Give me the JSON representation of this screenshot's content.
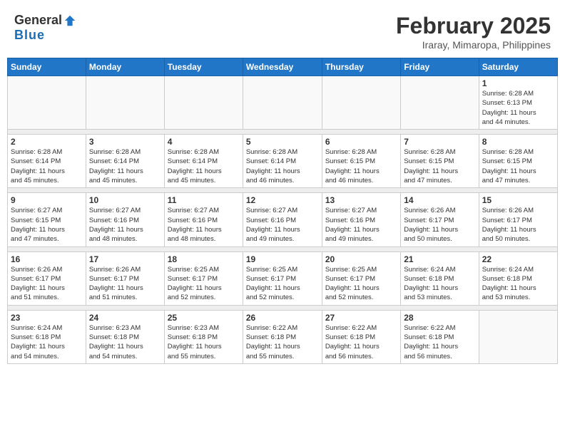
{
  "logo": {
    "general": "General",
    "blue": "Blue"
  },
  "header": {
    "month": "February 2025",
    "location": "Iraray, Mimaropa, Philippines"
  },
  "weekdays": [
    "Sunday",
    "Monday",
    "Tuesday",
    "Wednesday",
    "Thursday",
    "Friday",
    "Saturday"
  ],
  "weeks": [
    [
      {
        "day": "",
        "info": ""
      },
      {
        "day": "",
        "info": ""
      },
      {
        "day": "",
        "info": ""
      },
      {
        "day": "",
        "info": ""
      },
      {
        "day": "",
        "info": ""
      },
      {
        "day": "",
        "info": ""
      },
      {
        "day": "1",
        "info": "Sunrise: 6:28 AM\nSunset: 6:13 PM\nDaylight: 11 hours\nand 44 minutes."
      }
    ],
    [
      {
        "day": "2",
        "info": "Sunrise: 6:28 AM\nSunset: 6:14 PM\nDaylight: 11 hours\nand 45 minutes."
      },
      {
        "day": "3",
        "info": "Sunrise: 6:28 AM\nSunset: 6:14 PM\nDaylight: 11 hours\nand 45 minutes."
      },
      {
        "day": "4",
        "info": "Sunrise: 6:28 AM\nSunset: 6:14 PM\nDaylight: 11 hours\nand 45 minutes."
      },
      {
        "day": "5",
        "info": "Sunrise: 6:28 AM\nSunset: 6:14 PM\nDaylight: 11 hours\nand 46 minutes."
      },
      {
        "day": "6",
        "info": "Sunrise: 6:28 AM\nSunset: 6:15 PM\nDaylight: 11 hours\nand 46 minutes."
      },
      {
        "day": "7",
        "info": "Sunrise: 6:28 AM\nSunset: 6:15 PM\nDaylight: 11 hours\nand 47 minutes."
      },
      {
        "day": "8",
        "info": "Sunrise: 6:28 AM\nSunset: 6:15 PM\nDaylight: 11 hours\nand 47 minutes."
      }
    ],
    [
      {
        "day": "9",
        "info": "Sunrise: 6:27 AM\nSunset: 6:15 PM\nDaylight: 11 hours\nand 47 minutes."
      },
      {
        "day": "10",
        "info": "Sunrise: 6:27 AM\nSunset: 6:16 PM\nDaylight: 11 hours\nand 48 minutes."
      },
      {
        "day": "11",
        "info": "Sunrise: 6:27 AM\nSunset: 6:16 PM\nDaylight: 11 hours\nand 48 minutes."
      },
      {
        "day": "12",
        "info": "Sunrise: 6:27 AM\nSunset: 6:16 PM\nDaylight: 11 hours\nand 49 minutes."
      },
      {
        "day": "13",
        "info": "Sunrise: 6:27 AM\nSunset: 6:16 PM\nDaylight: 11 hours\nand 49 minutes."
      },
      {
        "day": "14",
        "info": "Sunrise: 6:26 AM\nSunset: 6:17 PM\nDaylight: 11 hours\nand 50 minutes."
      },
      {
        "day": "15",
        "info": "Sunrise: 6:26 AM\nSunset: 6:17 PM\nDaylight: 11 hours\nand 50 minutes."
      }
    ],
    [
      {
        "day": "16",
        "info": "Sunrise: 6:26 AM\nSunset: 6:17 PM\nDaylight: 11 hours\nand 51 minutes."
      },
      {
        "day": "17",
        "info": "Sunrise: 6:26 AM\nSunset: 6:17 PM\nDaylight: 11 hours\nand 51 minutes."
      },
      {
        "day": "18",
        "info": "Sunrise: 6:25 AM\nSunset: 6:17 PM\nDaylight: 11 hours\nand 52 minutes."
      },
      {
        "day": "19",
        "info": "Sunrise: 6:25 AM\nSunset: 6:17 PM\nDaylight: 11 hours\nand 52 minutes."
      },
      {
        "day": "20",
        "info": "Sunrise: 6:25 AM\nSunset: 6:17 PM\nDaylight: 11 hours\nand 52 minutes."
      },
      {
        "day": "21",
        "info": "Sunrise: 6:24 AM\nSunset: 6:18 PM\nDaylight: 11 hours\nand 53 minutes."
      },
      {
        "day": "22",
        "info": "Sunrise: 6:24 AM\nSunset: 6:18 PM\nDaylight: 11 hours\nand 53 minutes."
      }
    ],
    [
      {
        "day": "23",
        "info": "Sunrise: 6:24 AM\nSunset: 6:18 PM\nDaylight: 11 hours\nand 54 minutes."
      },
      {
        "day": "24",
        "info": "Sunrise: 6:23 AM\nSunset: 6:18 PM\nDaylight: 11 hours\nand 54 minutes."
      },
      {
        "day": "25",
        "info": "Sunrise: 6:23 AM\nSunset: 6:18 PM\nDaylight: 11 hours\nand 55 minutes."
      },
      {
        "day": "26",
        "info": "Sunrise: 6:22 AM\nSunset: 6:18 PM\nDaylight: 11 hours\nand 55 minutes."
      },
      {
        "day": "27",
        "info": "Sunrise: 6:22 AM\nSunset: 6:18 PM\nDaylight: 11 hours\nand 56 minutes."
      },
      {
        "day": "28",
        "info": "Sunrise: 6:22 AM\nSunset: 6:18 PM\nDaylight: 11 hours\nand 56 minutes."
      },
      {
        "day": "",
        "info": ""
      }
    ]
  ]
}
